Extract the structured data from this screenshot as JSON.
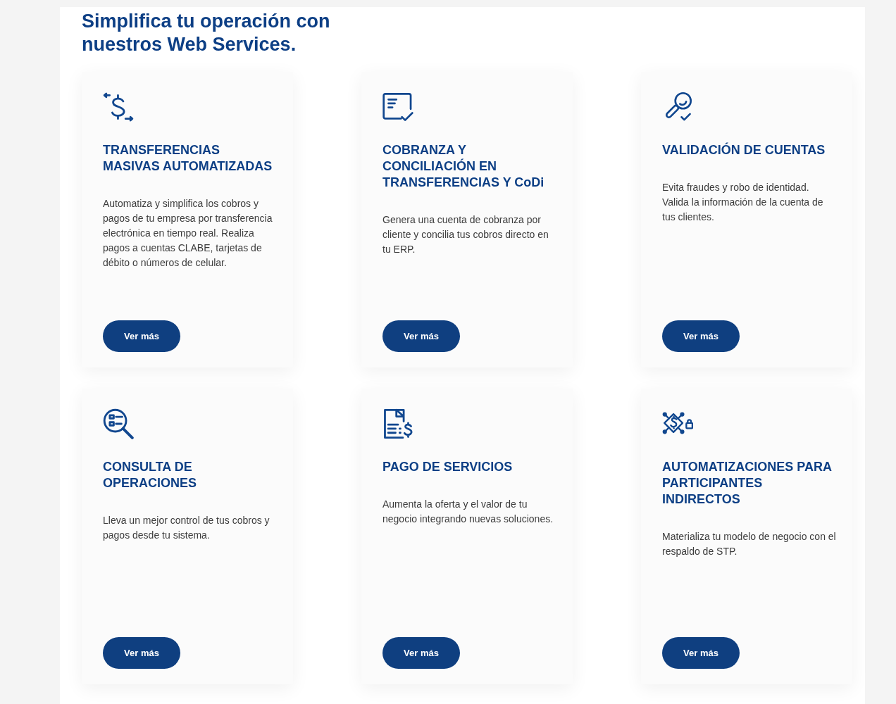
{
  "section": {
    "title": "Simplifica tu operación con nuestros Web Services."
  },
  "cards": [
    {
      "title": "TRANSFERENCIAS MASIVAS AUTOMATIZADAS",
      "description": "Automatiza y simplifica los cobros y pagos de tu empresa por transferencia electrónica en tiempo real. Realiza pagos a cuentas CLABE, tarjetas de débito o números de celular.",
      "button": "Ver más"
    },
    {
      "title": "COBRANZA Y CONCILIACIÓN EN TRANSFERENCIAS Y CoDi",
      "description": "Genera una cuenta de cobranza por cliente y concilia tus cobros directo en tu ERP.",
      "button": "Ver más"
    },
    {
      "title": "VALIDACIÓN DE CUENTAS",
      "description": "Evita fraudes y robo de identidad. Valida la información de la cuenta de tus clientes.",
      "button": "Ver más"
    },
    {
      "title": "CONSULTA DE OPERACIONES",
      "description": "Lleva un mejor control de tus cobros y pagos desde tu sistema.",
      "button": "Ver más"
    },
    {
      "title": "PAGO DE SERVICIOS",
      "description": "Aumenta la oferta y el valor de tu negocio integrando nuevas soluciones.",
      "button": "Ver más"
    },
    {
      "title": "AUTOMATIZACIONES PARA PARTICIPANTES INDIRECTOS",
      "description": "Materializa tu modelo de negocio con el respaldo de STP.",
      "button": "Ver más"
    }
  ]
}
